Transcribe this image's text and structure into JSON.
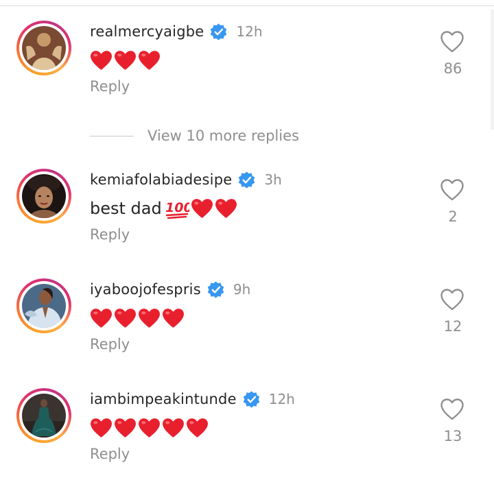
{
  "comments": [
    {
      "username": "realmercyaigbe",
      "time": "12h",
      "text": "",
      "hearts": 3,
      "hundred": false,
      "reply_label": "Reply",
      "likes": "86",
      "avatar_colors": [
        "#7a4a33",
        "#c89a6a",
        "#e0c49a"
      ]
    },
    {
      "username": "kemiafolabiadesipe",
      "time": "3h",
      "text": "best dad",
      "hearts": 2,
      "hundred": true,
      "reply_label": "Reply",
      "likes": "2",
      "avatar_colors": [
        "#1c1412",
        "#b5835f",
        "#e8d0b8"
      ]
    },
    {
      "username": "iyaboojofespris",
      "time": "9h",
      "text": "",
      "hearts": 4,
      "hundred": false,
      "reply_label": "Reply",
      "likes": "12",
      "avatar_colors": [
        "#4b6a88",
        "#d7e3ef",
        "#8b5a3c"
      ]
    },
    {
      "username": "iambimpeakintunde",
      "time": "12h",
      "text": "",
      "hearts": 5,
      "hundred": false,
      "reply_label": "Reply",
      "likes": "13",
      "avatar_colors": [
        "#3a3431",
        "#1f5d5a",
        "#2b2420"
      ]
    }
  ],
  "view_more": {
    "label": "View 10 more replies"
  },
  "colors": {
    "verified": "#3897f0",
    "heart_emoji": "#e8202e",
    "secondary_text": "#8e8e8e",
    "primary_text": "#262626"
  },
  "icons": {
    "like": "heart-outline-icon",
    "verified": "verified-badge-icon",
    "emoji_heart": "red-heart-emoji",
    "emoji_100": "hundred-points-emoji"
  }
}
